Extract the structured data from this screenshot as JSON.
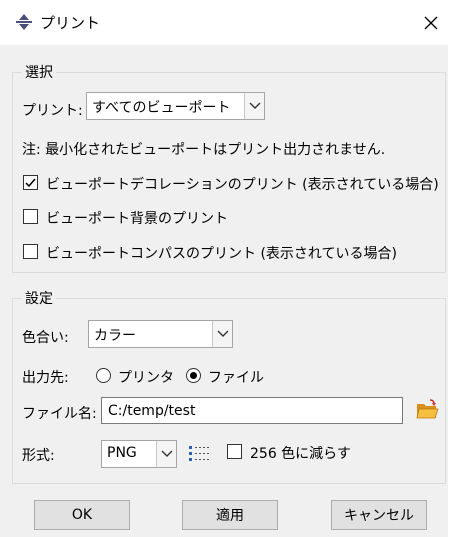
{
  "window": {
    "title": "プリント"
  },
  "selection": {
    "legend": "選択",
    "print_label": "プリント:",
    "print_value": "すべてのビューポート",
    "note": "注:  最小化されたビューポートはプリント出力されません.",
    "options": [
      {
        "label": "ビューポートデコレーションのプリント (表示されている場合)",
        "checked": true
      },
      {
        "label": "ビューポート背景のプリント",
        "checked": false
      },
      {
        "label": "ビューポートコンパスのプリント (表示されている場合)",
        "checked": false
      }
    ]
  },
  "settings": {
    "legend": "設定",
    "color_label": "色合い:",
    "color_value": "カラー",
    "dest_label": "出力先:",
    "dest_printer": "プリンタ",
    "dest_file": "ファイル",
    "dest_selected": "file",
    "filename_label": "ファイル名:",
    "filename_value": "C:/temp/test",
    "format_label": "形式:",
    "format_value": "PNG",
    "reduce_colors_label": "256 色に減らす",
    "reduce_colors_checked": false
  },
  "buttons": {
    "ok": "OK",
    "apply": "適用",
    "cancel": "キャンセル"
  },
  "colors": {
    "accent": "#4a4f7a",
    "folder": "#e8a020"
  },
  "icons": {
    "app": "abaqus-icon",
    "close": "close-icon",
    "dropdown": "chevron-down-icon",
    "folder": "folder-open-icon",
    "format_options": "format-options-icon",
    "checkmark": "check-icon"
  }
}
